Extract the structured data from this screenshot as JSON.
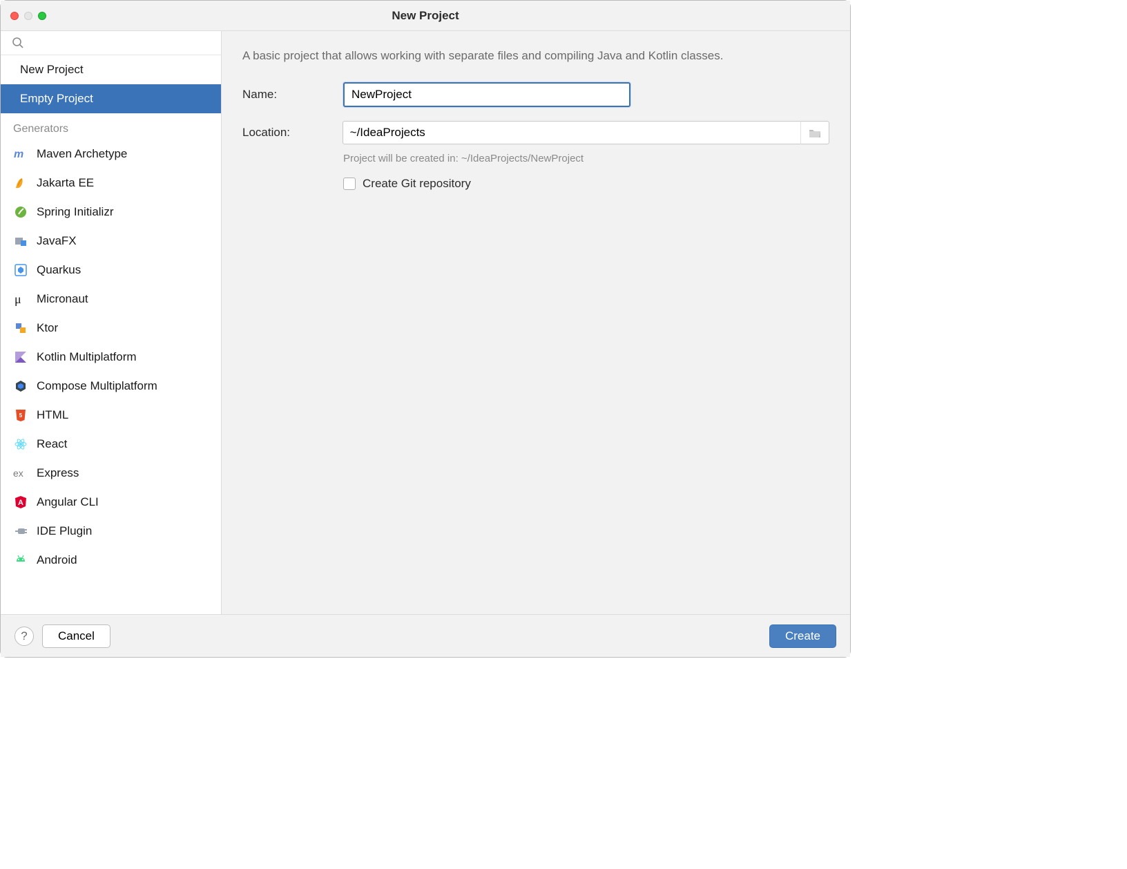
{
  "window": {
    "title": "New Project"
  },
  "sidebar": {
    "top_items": [
      {
        "label": "New Project",
        "selected": false
      },
      {
        "label": "Empty Project",
        "selected": true
      }
    ],
    "section_label": "Generators",
    "generators": [
      {
        "label": "Maven Archetype",
        "icon": "maven"
      },
      {
        "label": "Jakarta EE",
        "icon": "jakarta"
      },
      {
        "label": "Spring Initializr",
        "icon": "spring"
      },
      {
        "label": "JavaFX",
        "icon": "javafx"
      },
      {
        "label": "Quarkus",
        "icon": "quarkus"
      },
      {
        "label": "Micronaut",
        "icon": "micronaut"
      },
      {
        "label": "Ktor",
        "icon": "ktor"
      },
      {
        "label": "Kotlin Multiplatform",
        "icon": "kotlin"
      },
      {
        "label": "Compose Multiplatform",
        "icon": "compose"
      },
      {
        "label": "HTML",
        "icon": "html"
      },
      {
        "label": "React",
        "icon": "react"
      },
      {
        "label": "Express",
        "icon": "express"
      },
      {
        "label": "Angular CLI",
        "icon": "angular"
      },
      {
        "label": "IDE Plugin",
        "icon": "plug"
      },
      {
        "label": "Android",
        "icon": "android"
      }
    ]
  },
  "main": {
    "description": "A basic project that allows working with separate files and compiling Java and Kotlin classes.",
    "name_label": "Name:",
    "name_value": "NewProject",
    "location_label": "Location:",
    "location_value": "~/IdeaProjects",
    "location_hint": "Project will be created in: ~/IdeaProjects/NewProject",
    "git_checkbox_label": "Create Git repository"
  },
  "footer": {
    "help": "?",
    "cancel": "Cancel",
    "create": "Create"
  }
}
